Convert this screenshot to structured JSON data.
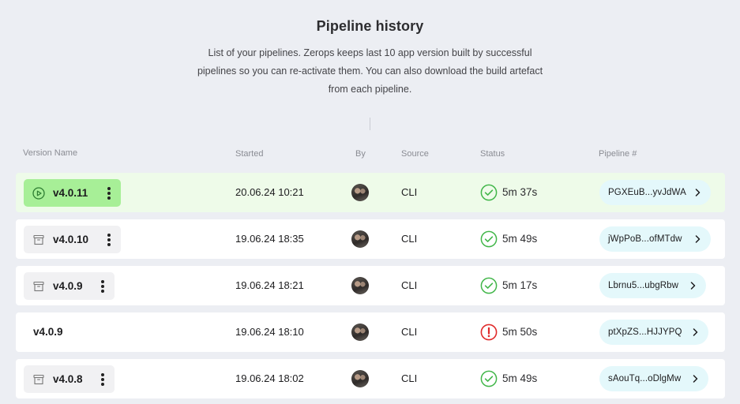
{
  "page": {
    "title": "Pipeline history",
    "description": "List of your pipelines. Zerops keeps last 10 app version built by successful pipelines so you can re-activate them. You can also download the build artefact from each pipeline."
  },
  "columns": {
    "version": "Version Name",
    "started": "Started",
    "by": "By",
    "source": "Source",
    "status": "Status",
    "pipeline": "Pipeline #"
  },
  "colors": {
    "active_row": "#eefbe9",
    "active_pill": "#a7ef97",
    "success": "#41b649",
    "error": "#e02a2a",
    "pipeline_pill": "#e4f8fb"
  },
  "rows": [
    {
      "version": "v4.0.11",
      "version_icon": "play-circle-icon",
      "variant": "active",
      "started": "20.06.24 10:21",
      "source": "CLI",
      "status_icon": "check-circle-icon",
      "duration": "5m 37s",
      "pipeline": "PGXEuB...yvJdWA"
    },
    {
      "version": "v4.0.10",
      "version_icon": "archive-icon",
      "variant": "archived",
      "started": "19.06.24 18:35",
      "source": "CLI",
      "status_icon": "check-circle-icon",
      "duration": "5m 49s",
      "pipeline": "jWpPoB...ofMTdw"
    },
    {
      "version": "v4.0.9",
      "version_icon": "archive-icon",
      "variant": "archived",
      "started": "19.06.24 18:21",
      "source": "CLI",
      "status_icon": "check-circle-icon",
      "duration": "5m 17s",
      "pipeline": "Lbrnu5...ubgRbw"
    },
    {
      "version": "v4.0.9",
      "version_icon": "",
      "variant": "plain",
      "started": "19.06.24 18:10",
      "source": "CLI",
      "status_icon": "alert-circle-icon",
      "duration": "5m 50s",
      "pipeline": "ptXpZS...HJJYPQ"
    },
    {
      "version": "v4.0.8",
      "version_icon": "archive-icon",
      "variant": "archived",
      "started": "19.06.24 18:02",
      "source": "CLI",
      "status_icon": "check-circle-icon",
      "duration": "5m 49s",
      "pipeline": "sAouTq...oDlgMw"
    }
  ]
}
